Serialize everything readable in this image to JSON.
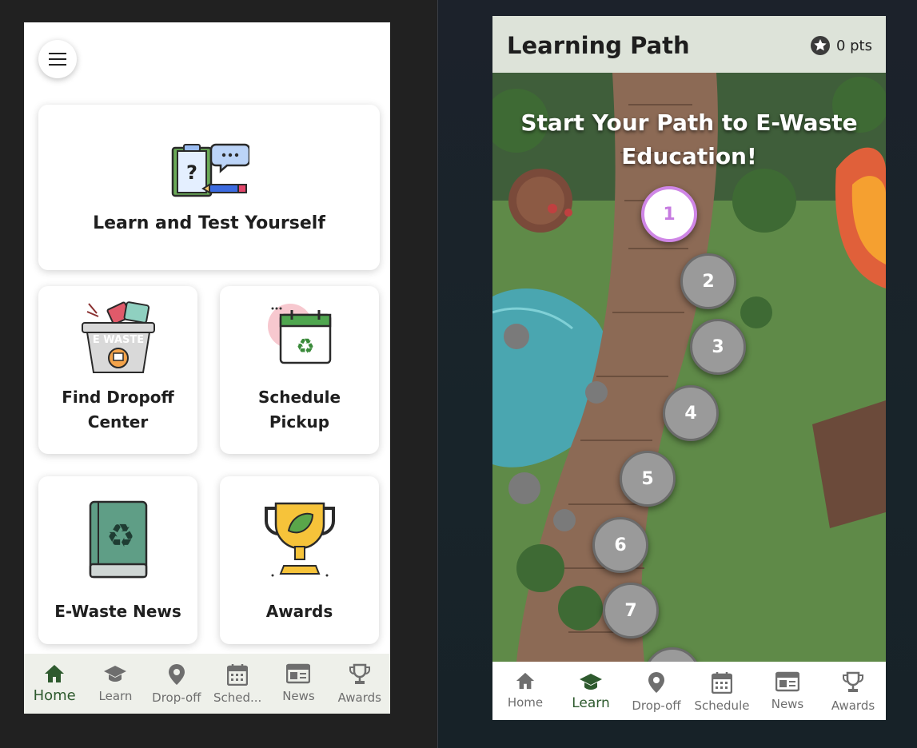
{
  "home": {
    "cards": [
      {
        "title": "Learn and Test Yourself",
        "icon": "quiz-clipboard-icon"
      },
      {
        "title": "Find Dropoff Center",
        "icon": "ewaste-bin-icon",
        "bin_label": "E WASTE"
      },
      {
        "title": "Schedule Pickup",
        "icon": "calendar-recycle-icon"
      },
      {
        "title": "E-Waste News",
        "icon": "recycle-book-icon"
      },
      {
        "title": "Awards",
        "icon": "trophy-leaf-icon"
      }
    ],
    "nav": [
      {
        "label": "Home",
        "icon": "home-icon",
        "active": true
      },
      {
        "label": "Learn",
        "icon": "graduation-cap-icon"
      },
      {
        "label": "Drop-off",
        "icon": "map-pin-icon"
      },
      {
        "label": "Sched...",
        "icon": "calendar-icon"
      },
      {
        "label": "News",
        "icon": "newspaper-icon"
      },
      {
        "label": "Awards",
        "icon": "trophy-icon"
      }
    ]
  },
  "learning": {
    "title": "Learning Path",
    "points": "0 pts",
    "heading": "Start Your Path to E-Waste Education!",
    "levels": [
      "1",
      "2",
      "3",
      "4",
      "5",
      "6",
      "7"
    ],
    "active_level": "1",
    "nav": [
      {
        "label": "Home",
        "icon": "home-icon"
      },
      {
        "label": "Learn",
        "icon": "graduation-cap-icon",
        "active": true
      },
      {
        "label": "Drop-off",
        "icon": "map-pin-icon"
      },
      {
        "label": "Schedule",
        "icon": "calendar-icon"
      },
      {
        "label": "News",
        "icon": "newspaper-icon"
      },
      {
        "label": "Awards",
        "icon": "trophy-icon"
      }
    ]
  },
  "colors": {
    "accent_green": "#2e5a2e",
    "active_node": "#cf86e6",
    "inactive_node": "#9a9a9a",
    "header_bg": "#dde3d9",
    "nav_bg": "#eef0ea"
  }
}
